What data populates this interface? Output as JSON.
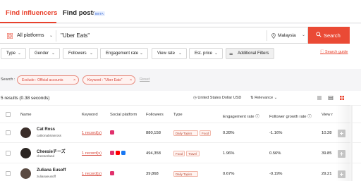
{
  "tabs": [
    {
      "label": "Find influencers",
      "active": true
    },
    {
      "label": "Find posts",
      "badge": "BETA"
    }
  ],
  "search": {
    "platform_label": "All platforms",
    "query": "\"Uber Eats\"",
    "country": "Malaysia",
    "button_label": "Search",
    "guide_label": "Search guide"
  },
  "filters": [
    "Type",
    "Gender",
    "Followers",
    "Engagement rate",
    "View rate",
    "Est. price",
    "Additional Filters"
  ],
  "active_filters": {
    "label": "Search :",
    "chips": [
      "Exclude : Official accounts",
      "Keyword : \"Uber Eats\""
    ],
    "reset_label": "Reset"
  },
  "results": {
    "count_label": "5 results (0.38 seconds)",
    "currency": "United States Dollar USD",
    "sort": "Relevance"
  },
  "table": {
    "headers": [
      "Name",
      "Keyword",
      "Social platform",
      "Followers",
      "Type",
      "Engagement rate",
      "Follower growth rate",
      "View r"
    ],
    "rows": [
      {
        "name": "Cat Ross",
        "handle": "cattionabrianross",
        "keyword": "1 record(s)",
        "socials": [
          "instagram"
        ],
        "followers": "880,158",
        "types": [
          "Daily Topics",
          "Food"
        ],
        "engagement": "0.28%",
        "growth": "-1.16%",
        "view_rate": "10.28"
      },
      {
        "name": "Cheesieチーズ",
        "handle": "cheeserland",
        "keyword": "1 record(s)",
        "socials": [
          "instagram",
          "youtube",
          "facebook"
        ],
        "followers": "494,358",
        "types": [
          "Food",
          "Travel"
        ],
        "engagement": "1.96%",
        "growth": "0.56%",
        "view_rate": "39.85"
      },
      {
        "name": "Zuliana Eusoff",
        "handle": "zulianaeusoff",
        "keyword": "1 record(s)",
        "socials": [
          "instagram"
        ],
        "followers": "39,868",
        "types": [
          "Daily Topics"
        ],
        "engagement": "0.67%",
        "growth": "-0.19%",
        "view_rate": "29.21"
      }
    ]
  },
  "colors": {
    "accent": "#e8412c",
    "button": "#ea4a35",
    "instagram": "#e1306c",
    "youtube": "#ff0000",
    "facebook": "#1877f2"
  }
}
